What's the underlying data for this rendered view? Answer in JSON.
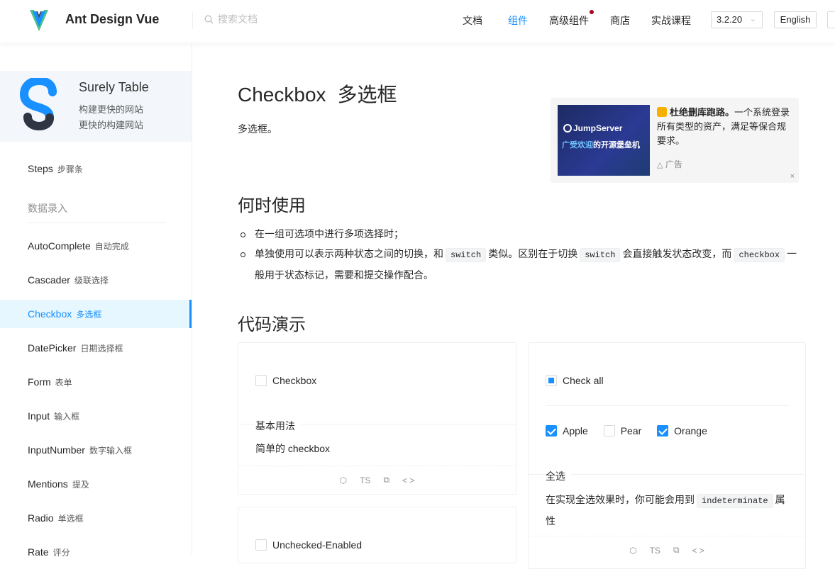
{
  "header": {
    "brand": "Ant Design Vue",
    "search_placeholder": "搜索文档",
    "nav": [
      "文档",
      "组件",
      "高级组件",
      "商店",
      "实战课程"
    ],
    "active_nav": "组件",
    "version": "3.2.20",
    "language": "English",
    "accent_color": "#1890ff"
  },
  "sidebar": {
    "promo": {
      "title": "Surely Table",
      "line1": "构建更快的网站",
      "line2": "更快的构建网站"
    },
    "group_title": "数据录入",
    "items": [
      {
        "en": "Steps",
        "zh": "步骤条"
      },
      {
        "en": "AutoComplete",
        "zh": "自动完成"
      },
      {
        "en": "Cascader",
        "zh": "级联选择"
      },
      {
        "en": "Checkbox",
        "zh": "多选框"
      },
      {
        "en": "DatePicker",
        "zh": "日期选择框"
      },
      {
        "en": "Form",
        "zh": "表单"
      },
      {
        "en": "Input",
        "zh": "输入框"
      },
      {
        "en": "InputNumber",
        "zh": "数字输入框"
      },
      {
        "en": "Mentions",
        "zh": "提及"
      },
      {
        "en": "Radio",
        "zh": "单选框"
      },
      {
        "en": "Rate",
        "zh": "评分"
      }
    ]
  },
  "main": {
    "title_en": "Checkbox",
    "title_zh": "多选框",
    "description": "多选框。",
    "ad": {
      "image_brand": "JumpServer",
      "image_slogan_hi": "广受欢迎",
      "image_slogan_rest": "的开源堡垒机",
      "headline": "杜绝删库跑路。",
      "text": "一个系统登录所有类型的资产，满足等保合规要求。",
      "label": "广告",
      "close": "×"
    },
    "when_title": "何时使用",
    "bullet1": "在一组可选项中进行多项选择时；",
    "bullet2_a": "单独使用可以表示两种状态之间的切换，和",
    "code_switch": "switch",
    "bullet2_b": "类似。区别在于切换",
    "bullet2_c": "会直接触发状态改变，而",
    "code_checkbox": "checkbox",
    "bullet2_d": "一般用于状态标记，需要和提交操作配合。",
    "demo_title": "代码演示",
    "demo_basic": {
      "checkbox_label": "Checkbox",
      "meta_title": "基本用法",
      "meta_desc": "简单的 checkbox",
      "action_ts": "TS"
    },
    "demo_checkall": {
      "checkall_label": "Check all",
      "options": [
        {
          "label": "Apple",
          "checked": true
        },
        {
          "label": "Pear",
          "checked": false
        },
        {
          "label": "Orange",
          "checked": true
        }
      ],
      "meta_title": "全选",
      "meta_desc_a": "在实现全选效果时，你可能会用到",
      "code_indeterminate": "indeterminate",
      "meta_desc_b": "属",
      "meta_desc_c": "性",
      "action_ts": "TS"
    },
    "demo_states": {
      "checkbox_label": "Unchecked-Enabled"
    }
  }
}
